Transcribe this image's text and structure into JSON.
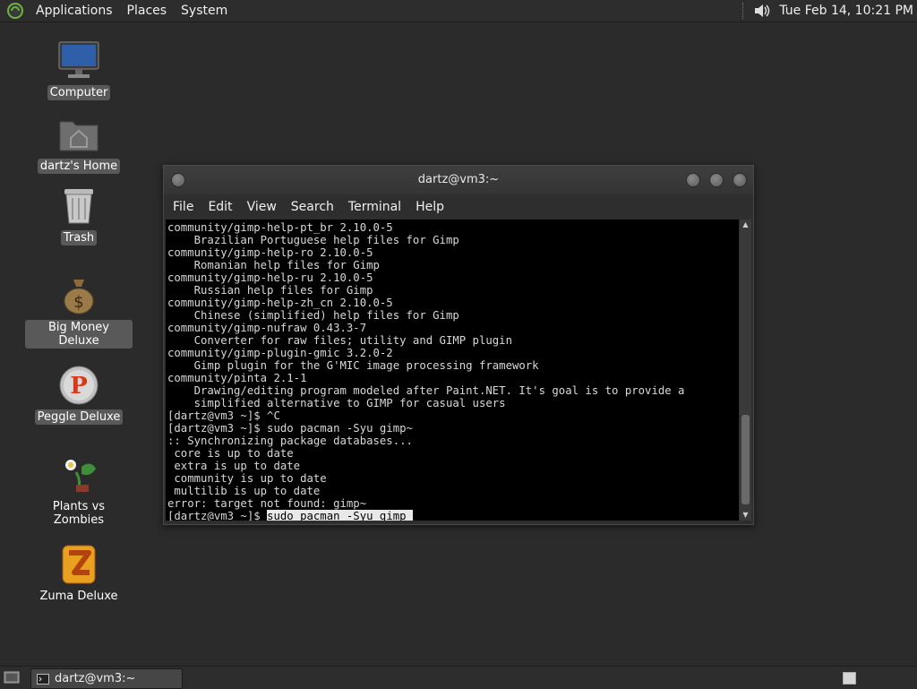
{
  "top_panel": {
    "menus": [
      "Applications",
      "Places",
      "System"
    ],
    "clock": "Tue Feb 14, 10:21 PM"
  },
  "desktop": {
    "icons": [
      {
        "label": "Computer",
        "icon": "computer-icon",
        "selected": true
      },
      {
        "label": "dartz's Home",
        "icon": "home-folder-icon",
        "selected": true
      },
      {
        "label": "Trash",
        "icon": "trash-icon",
        "selected": true
      },
      {
        "label": "Big Money Deluxe",
        "icon": "money-bag-icon",
        "selected": true
      },
      {
        "label": "Peggle Deluxe",
        "icon": "peggle-icon",
        "selected": true
      },
      {
        "label": "Plants vs Zombies",
        "icon": "plants-vs-zombies-icon",
        "selected": false
      },
      {
        "label": "Zuma Deluxe",
        "icon": "zuma-icon",
        "selected": false
      }
    ]
  },
  "terminal": {
    "title": "dartz@vm3:~",
    "menu": [
      "File",
      "Edit",
      "View",
      "Search",
      "Terminal",
      "Help"
    ],
    "lines": [
      "community/gimp-help-pt_br 2.10.0-5",
      "    Brazilian Portuguese help files for Gimp",
      "community/gimp-help-ro 2.10.0-5",
      "    Romanian help files for Gimp",
      "community/gimp-help-ru 2.10.0-5",
      "    Russian help files for Gimp",
      "community/gimp-help-zh_cn 2.10.0-5",
      "    Chinese (simplified) help files for Gimp",
      "community/gimp-nufraw 0.43.3-7",
      "    Converter for raw files; utility and GIMP plugin",
      "community/gimp-plugin-gmic 3.2.0-2",
      "    Gimp plugin for the G'MIC image processing framework",
      "community/pinta 2.1-1",
      "    Drawing/editing program modeled after Paint.NET. It's goal is to provide a",
      "    simplified alternative to GIMP for casual users",
      "[dartz@vm3 ~]$ ^C",
      "[dartz@vm3 ~]$ sudo pacman -Syu gimp~",
      ":: Synchronizing package databases...",
      " core is up to date",
      " extra is up to date",
      " community is up to date",
      " multilib is up to date",
      "error: target not found: gimp~"
    ],
    "prompt": "[dartz@vm3 ~]$ ",
    "current_input": "sudo pacman -Syu gimp "
  },
  "taskbar": {
    "task_label": "dartz@vm3:~"
  },
  "colors": {
    "desktop_bg": "#2b2b2b",
    "panel_bg": "#2d2d2d",
    "terminal_bg": "#000000",
    "terminal_fg": "#d8d8d8"
  }
}
